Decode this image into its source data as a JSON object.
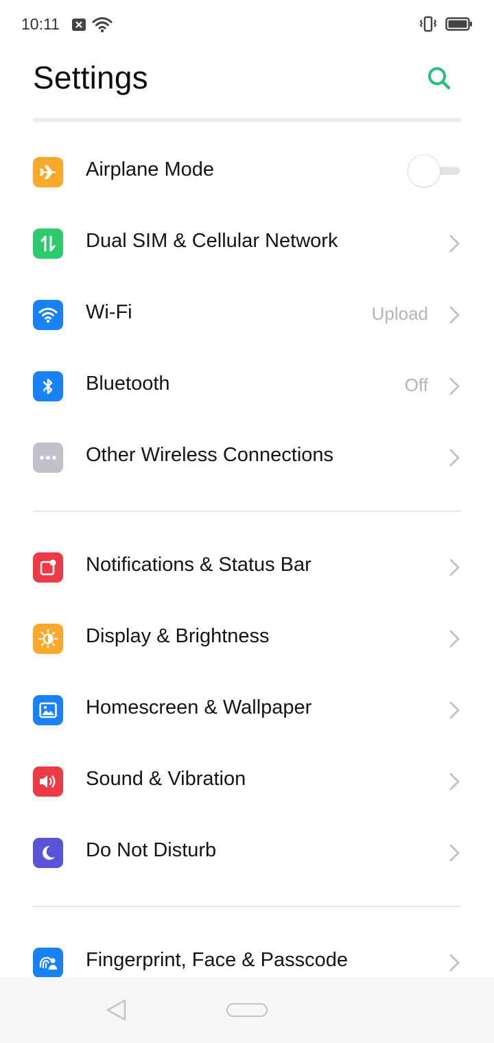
{
  "status_bar": {
    "time": "10:11",
    "left_icons": [
      "notification-x-icon",
      "wifi-signal-icon"
    ],
    "right_icons": [
      "vibrate-icon",
      "battery-icon"
    ]
  },
  "header": {
    "title": "Settings",
    "search_icon": "search-icon"
  },
  "colors": {
    "accent": "#2bbd7e",
    "orange": "#fba72a",
    "green": "#2ecb6e",
    "blue": "#1a82f7",
    "gray": "#c0c1c9",
    "red": "#ee3b48",
    "purple": "#5a54d6"
  },
  "settings": {
    "airplane": {
      "label": "Airplane Mode",
      "icon": "airplane-icon",
      "toggle_on": false
    },
    "dual_sim": {
      "label": "Dual SIM & Cellular Network",
      "icon": "cellular-data-icon"
    },
    "wifi": {
      "label": "Wi-Fi",
      "value": "Upload",
      "icon": "wifi-icon"
    },
    "bluetooth": {
      "label": "Bluetooth",
      "value": "Off",
      "icon": "bluetooth-icon"
    },
    "other_wireless": {
      "label": "Other Wireless Connections",
      "icon": "more-dots-icon"
    },
    "notifications": {
      "label": "Notifications & Status Bar",
      "icon": "notification-badge-icon"
    },
    "display": {
      "label": "Display & Brightness",
      "icon": "brightness-icon"
    },
    "homescreen": {
      "label": "Homescreen & Wallpaper",
      "icon": "wallpaper-icon"
    },
    "sound": {
      "label": "Sound & Vibration",
      "icon": "speaker-icon"
    },
    "dnd": {
      "label": "Do Not Disturb",
      "icon": "moon-icon"
    },
    "fingerprint": {
      "label": "Fingerprint, Face & Passcode",
      "icon": "fingerprint-icon"
    }
  },
  "nav_bar": {
    "back_icon": "back-triangle-icon",
    "home_icon": "home-pill-icon"
  }
}
